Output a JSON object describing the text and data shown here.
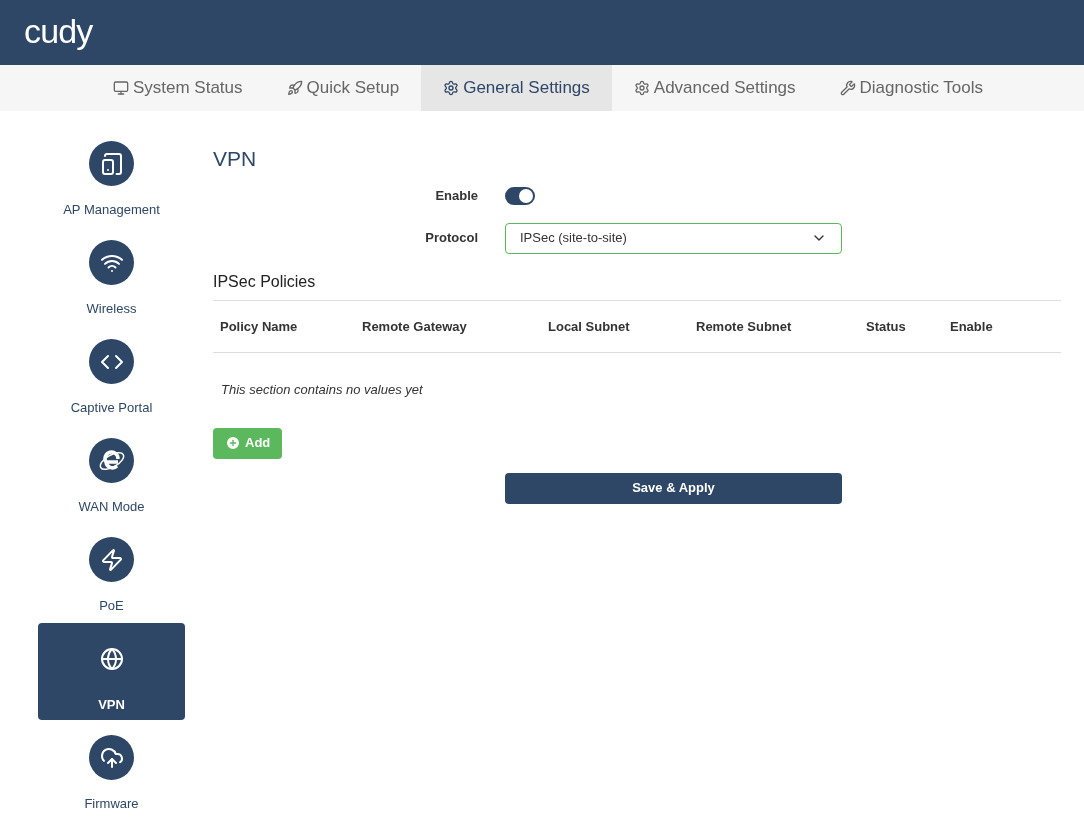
{
  "header": {
    "logo": "cudy"
  },
  "tabs": [
    {
      "label": "System Status",
      "selected": false
    },
    {
      "label": "Quick Setup",
      "selected": false
    },
    {
      "label": "General Settings",
      "selected": true
    },
    {
      "label": "Advanced Settings",
      "selected": false
    },
    {
      "label": "Diagnostic Tools",
      "selected": false
    }
  ],
  "sidebar": {
    "items": [
      {
        "label": "AP Management",
        "selected": false
      },
      {
        "label": "Wireless",
        "selected": false
      },
      {
        "label": "Captive Portal",
        "selected": false
      },
      {
        "label": "WAN Mode",
        "selected": false
      },
      {
        "label": "PoE",
        "selected": false
      },
      {
        "label": "VPN",
        "selected": true
      },
      {
        "label": "Firmware",
        "selected": false
      }
    ]
  },
  "page": {
    "title": "VPN",
    "enable": {
      "label": "Enable",
      "on": true
    },
    "protocol": {
      "label": "Protocol",
      "value": "IPSec (site-to-site)"
    },
    "section_title": "IPSec Policies",
    "table": {
      "columns": [
        "Policy Name",
        "Remote Gateway",
        "Local Subnet",
        "Remote Subnet",
        "Status",
        "Enable"
      ],
      "empty_text": "This section contains no values yet"
    },
    "add_button": "Add",
    "save_button": "Save & Apply"
  }
}
